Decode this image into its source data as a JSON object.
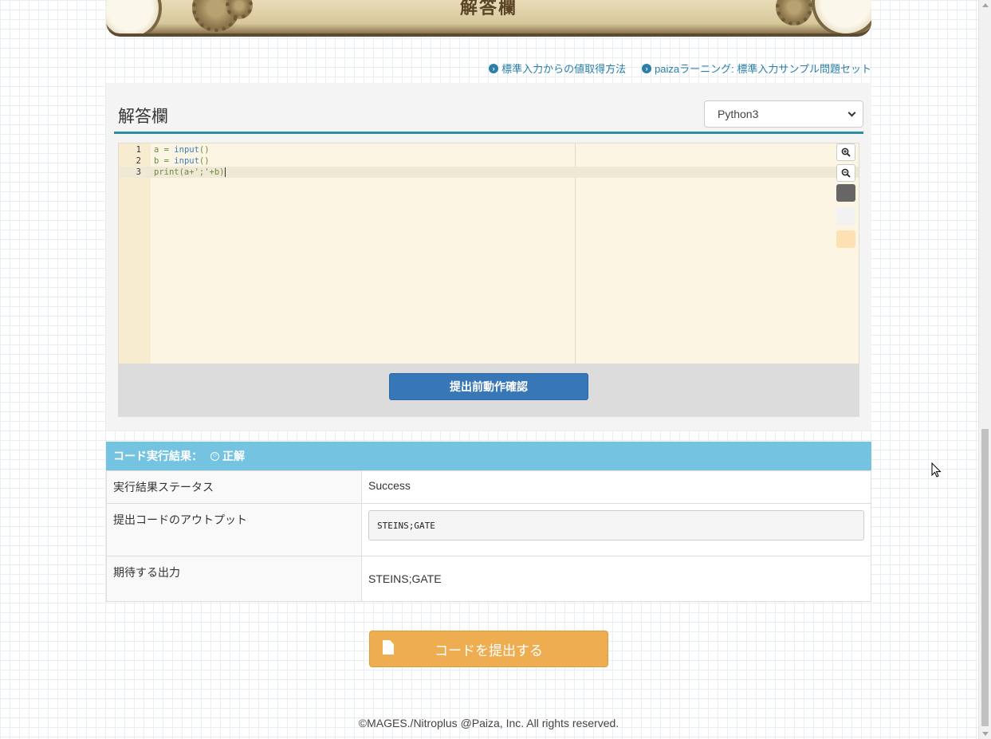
{
  "banner": {
    "title": "解答欄"
  },
  "links": [
    {
      "label": "標準入力からの値取得方法"
    },
    {
      "label": "paizaラーニング: 標準入力サンプル問題セット"
    }
  ],
  "answer": {
    "title": "解答欄",
    "language": "Python3",
    "code_lines": [
      {
        "num": "1",
        "pre": "a = ",
        "fn": "input",
        "post": "()"
      },
      {
        "num": "2",
        "pre": "b = ",
        "fn": "input",
        "post": "()"
      },
      {
        "num": "3",
        "pre": "",
        "fn": "",
        "post": "print(a+';'+b)"
      }
    ],
    "check_button": "提出前動作確認",
    "swatches": [
      "#666666",
      "#f2f2f2",
      "#fde0b4"
    ]
  },
  "result": {
    "heading": "コード実行結果：",
    "verdict": "正解",
    "rows": {
      "status_label": "実行結果ステータス",
      "status_value": "Success",
      "output_label": "提出コードのアウトプット",
      "output_value": "STEINS;GATE",
      "expected_label": "期待する出力",
      "expected_value": "STEINS;GATE"
    }
  },
  "submit_button": "コードを提出する",
  "footer": "©MAGES./Nitroplus @Paiza, Inc. All rights reserved."
}
